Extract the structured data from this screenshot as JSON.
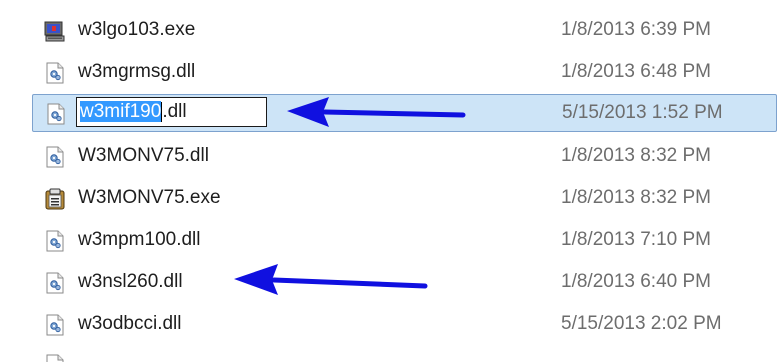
{
  "files": [
    {
      "name": "w3lgo103.exe",
      "date": "1/8/2013 6:39 PM",
      "icon": "application-exe-icon"
    },
    {
      "name": "w3mgrmsg.dll",
      "date": "1/8/2013 6:48 PM",
      "icon": "dll-file-icon"
    },
    {
      "name_selected_part": "w3mif190",
      "name_rest": ".dll",
      "date": "5/15/2013 1:52 PM",
      "icon": "dll-file-icon",
      "state": "renaming"
    },
    {
      "name": "W3MONV75.dll",
      "date": "1/8/2013 8:32 PM",
      "icon": "dll-file-icon"
    },
    {
      "name": "W3MONV75.exe",
      "date": "1/8/2013 8:32 PM",
      "icon": "clipboard-exe-icon"
    },
    {
      "name": "w3mpm100.dll",
      "date": "1/8/2013 7:10 PM",
      "icon": "dll-file-icon"
    },
    {
      "name": "w3nsl260.dll",
      "date": "1/8/2013 6:40 PM",
      "icon": "dll-file-icon"
    },
    {
      "name": "w3odbcci.dll",
      "date": "5/15/2013 2:02 PM",
      "icon": "dll-file-icon"
    }
  ],
  "colors": {
    "selection_bg": "#cde4f7",
    "selection_border": "#7da2ce",
    "text_highlight": "#3399ff",
    "annotation_arrow": "#1010e0"
  }
}
